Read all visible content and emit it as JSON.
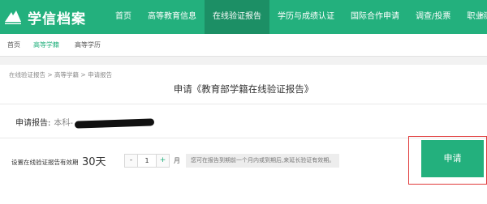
{
  "brand": {
    "name": "学信档案"
  },
  "nav": {
    "items": [
      "首页",
      "高等教育信息",
      "在线验证报告",
      "学历与成绩认证",
      "国际合作申请",
      "调查/投票",
      "职业测评"
    ],
    "active_index": 2,
    "user_glyph": "®"
  },
  "subnav": {
    "items": [
      "首页",
      "高等学籍",
      "高等学历"
    ],
    "active_index": 1
  },
  "breadcrumb": "在线验证报告 > 高等学籍 > 申请报告",
  "page_title": "申请《教育部学籍在线验证报告》",
  "apply_for": {
    "label": "申请报告:",
    "value": "本科-"
  },
  "validity": {
    "label": "设置在线验证报告有效期",
    "value": "30天",
    "months": "1",
    "minus": "-",
    "plus": "+",
    "unit": "月",
    "hint": "您可在报告到期前一个月内或到期后,来延长验证有效期。"
  },
  "apply_button": "申请",
  "colors": {
    "brand_green": "#23b07d",
    "active_nav": "#1c8f65",
    "highlight_red": "#e03b3b"
  }
}
